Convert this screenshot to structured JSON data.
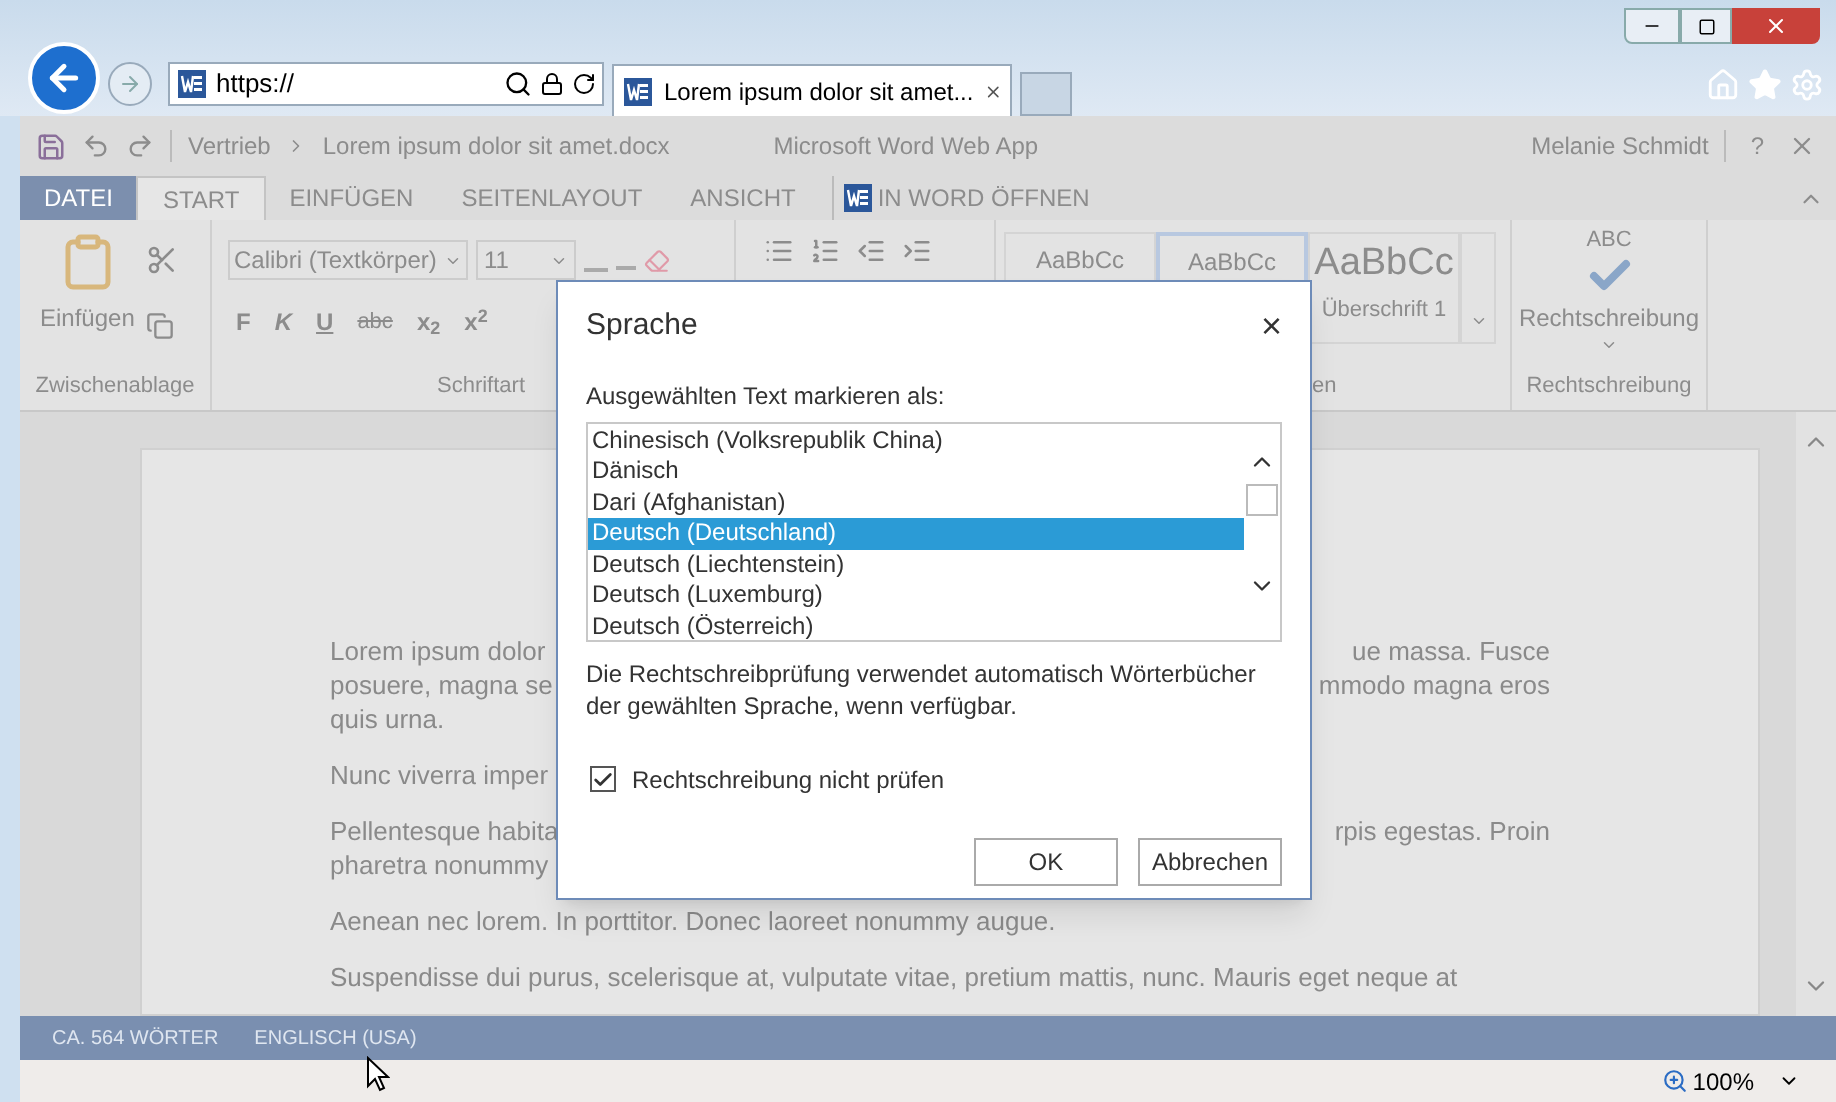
{
  "browser": {
    "url": "https://",
    "tab_title": "Lorem ipsum dolor sit amet..."
  },
  "app": {
    "breadcrumb": [
      "Vertrieb",
      "Lorem ipsum dolor sit amet.docx"
    ],
    "app_name": "Microsoft Word Web App",
    "user": "Melanie Schmidt",
    "help": "?"
  },
  "ribbon_tabs": [
    {
      "label": "DATEI",
      "kind": "file",
      "selected": false
    },
    {
      "label": "START",
      "kind": "tab",
      "selected": true
    },
    {
      "label": "EINFÜGEN",
      "kind": "tab",
      "selected": false
    },
    {
      "label": "SEITENLAYOUT",
      "kind": "tab",
      "selected": false
    },
    {
      "label": "ANSICHT",
      "kind": "tab",
      "selected": false
    },
    {
      "label": "IN WORD ÖFFNEN",
      "kind": "open",
      "selected": false
    }
  ],
  "ribbon": {
    "paste": "Einfügen",
    "font": "Calibri (Textkörper)",
    "size": "11",
    "format_buttons": [
      {
        "label": "F",
        "kind": "bold"
      },
      {
        "label": "K",
        "kind": "italic"
      },
      {
        "label": "U",
        "kind": "underline"
      },
      {
        "label": "abc",
        "kind": "strike"
      },
      {
        "label": "x$_{2}$",
        "kind": "plain"
      },
      {
        "label": "x$^{2}$",
        "kind": "plain"
      }
    ],
    "styles": [
      {
        "sample": "AaBbCc",
        "kind": "small",
        "selected": false
      },
      {
        "sample": "AaBbCc",
        "kind": "small",
        "selected": true
      },
      {
        "sample": "AaBbCc",
        "kind": "heading",
        "caption": "Überschrift 1",
        "selected": false
      }
    ],
    "spelling": {
      "badge": "ABC",
      "label": "Rechtschreibung"
    },
    "group_labels": [
      "Zwischenablage",
      "Schriftart",
      "en",
      "Rechtschreibung"
    ]
  },
  "document": {
    "paragraphs": [
      [
        {
          "left": "Lorem ipsum dolor",
          "right": "ue massa. Fusce"
        },
        {
          "left": "posuere, magna se",
          "right": "mmodo magna eros"
        },
        {
          "left": "quis urna."
        }
      ],
      [
        {
          "left": "Nunc viverra imper"
        }
      ],
      [
        {
          "left": "Pellentesque habita",
          "right": "rpis egestas. Proin"
        },
        {
          "left": "pharetra nonummy"
        }
      ],
      [
        {
          "left": "Aenean nec lorem. In porttitor. Donec laoreet nonummy augue."
        }
      ],
      [
        {
          "left": "Suspendisse dui purus, scelerisque at, vulputate vitae, pretium mattis, nunc. Mauris eget neque at"
        }
      ]
    ]
  },
  "dialog": {
    "title": "Sprache",
    "close": "×",
    "prompt": "Ausgewählten Text markieren als:",
    "languages": [
      {
        "label": "Chinesisch (Volksrepublik China)",
        "selected": false
      },
      {
        "label": "Dänisch",
        "selected": false
      },
      {
        "label": "Dari (Afghanistan)",
        "selected": false
      },
      {
        "label": "Deutsch (Deutschland)",
        "selected": true
      },
      {
        "label": "Deutsch (Liechtenstein)",
        "selected": false
      },
      {
        "label": "Deutsch (Luxemburg)",
        "selected": false
      },
      {
        "label": "Deutsch (Österreich)",
        "selected": false
      }
    ],
    "note": "Die Rechtschreibprüfung verwendet automatisch Wörterbücher der gewählten Sprache, wenn verfügbar.",
    "checkbox": {
      "label": "Rechtschreibung nicht prüfen",
      "checked": true
    },
    "buttons": [
      "OK",
      "Abbrechen"
    ]
  },
  "status_bar": {
    "words": "CA. 564 WÖRTER",
    "language": "ENGLISCH (USA)"
  },
  "zoom": "100%"
}
